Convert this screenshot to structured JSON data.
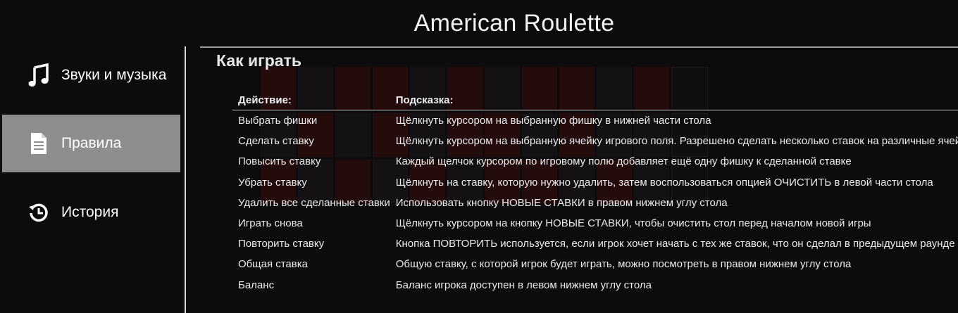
{
  "app": {
    "title": "American Roulette"
  },
  "sidebar": {
    "items": [
      {
        "label": "Звуки и музыка",
        "icon": "music-note-icon",
        "active": false
      },
      {
        "label": "Правила",
        "icon": "document-icon",
        "active": true
      },
      {
        "label": "История",
        "icon": "history-icon",
        "active": false
      }
    ]
  },
  "rules": {
    "title": "Как играть",
    "headers": {
      "action": "Действие:",
      "hint": "Подсказка:"
    },
    "rows": [
      {
        "action": "Выбрать фишки",
        "hint": "Щёлкнуть курсором на выбранную фишку в нижней части стола"
      },
      {
        "action": "Сделать ставку",
        "hint": "Щёлкнуть курсором на выбранную ячейку игрового поля. Разрешено сделать несколько ставок на различные ячейки"
      },
      {
        "action": "Повысить ставку",
        "hint": "Каждый щелчок курсором по игровому полю добавляет ещё одну фишку к сделанной ставке"
      },
      {
        "action": "Убрать ставку",
        "hint": "Щёлкнуть на ставку, которую нужно удалить, затем воспользоваться опцией ОЧИСТИТЬ в левой части стола"
      },
      {
        "action": "Удалить все сделанные ставки",
        "hint": "Использовать кнопку НОВЫЕ СТАВКИ в правом нижнем углу стола"
      },
      {
        "action": "Играть снова",
        "hint": "Щёлкнуть курсором на кнопку НОВЫЕ СТАВКИ, чтобы очистить стол перед началом новой игры"
      },
      {
        "action": "Повторить ставку",
        "hint": "Кнопка ПОВТОРИТЬ используется, если игрок хочет начать с тех же ставок, что он сделал в предыдущем раунде"
      },
      {
        "action": "Общая ставка",
        "hint": "Общую ставку, с которой игрок будет играть, можно посмотреть в правом нижнем углу стола"
      },
      {
        "action": "Баланс",
        "hint": "Баланс игрока доступен в левом нижнем углу стола"
      }
    ]
  },
  "colors": {
    "background": "#0d0b0b",
    "active_item": "#8e8e8e",
    "text": "#ffffff"
  }
}
